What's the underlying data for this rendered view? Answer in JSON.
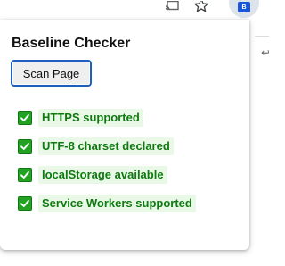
{
  "browser": {
    "toolbar_icons": [
      {
        "name": "cast-icon"
      },
      {
        "name": "bookmark-star-icon"
      },
      {
        "name": "extension-icon",
        "badge": "B"
      }
    ]
  },
  "popup": {
    "title": "Baseline Checker",
    "scan_button_label": "Scan Page",
    "checks": [
      {
        "label": "HTTPS supported",
        "status": "pass",
        "icon": "check-mark-icon"
      },
      {
        "label": "UTF-8 charset declared",
        "status": "pass",
        "icon": "check-mark-icon"
      },
      {
        "label": "localStorage available",
        "status": "pass",
        "icon": "check-mark-icon"
      },
      {
        "label": "Service Workers supported",
        "status": "pass",
        "icon": "check-mark-icon"
      }
    ]
  },
  "colors": {
    "pass_green": "#21a321",
    "pass_text": "#0f7a0f",
    "pass_bg": "#eaf8e8",
    "focus_blue": "#1f5fbf"
  }
}
